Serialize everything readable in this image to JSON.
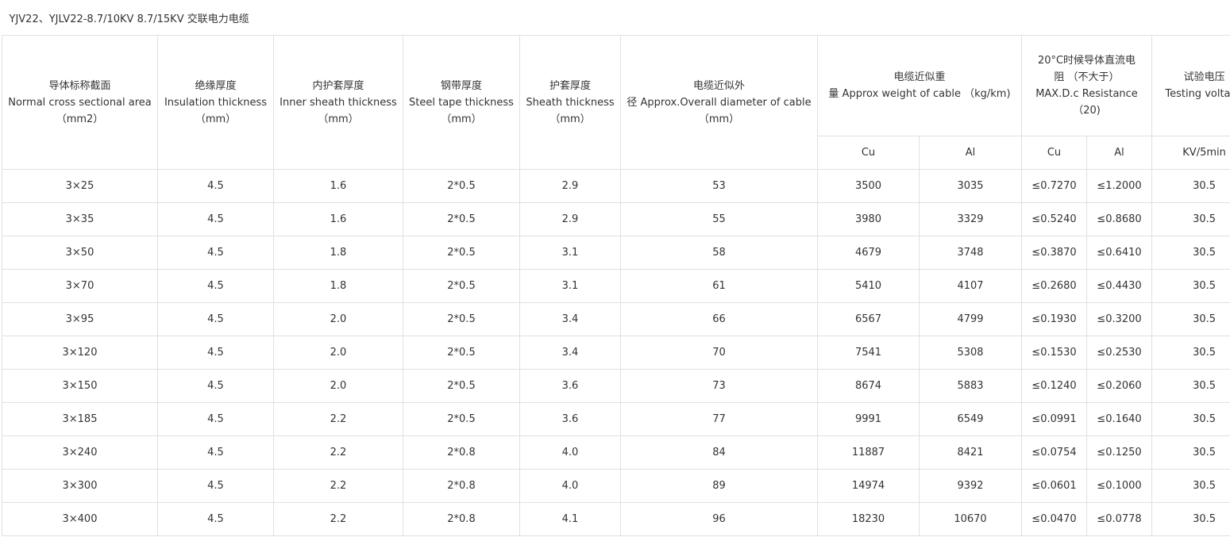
{
  "title": "YJV22、YJLV22-8.7/10KV  8.7/15KV  交联电力电缆",
  "headers": {
    "area": {
      "cn": "导体标称截面",
      "en": "Normal cross sectional area",
      "unit": "（mm2）"
    },
    "insulation": {
      "cn": "绝缘厚度",
      "en": "Insulation thickness",
      "unit": "（mm）"
    },
    "inner": {
      "cn": "内护套厚度",
      "en": "Inner sheath thickness",
      "unit": "（mm）"
    },
    "steel": {
      "cn": "钢带厚度",
      "en": "Steel tape thickness",
      "unit": "（mm）"
    },
    "sheath": {
      "cn": "护套厚度",
      "en": "Sheath thickness",
      "unit": "（mm）"
    },
    "diameter": {
      "line1": "电缆近似外",
      "line2": "径 Approx.Overall diameter of cable",
      "unit": "（mm）"
    },
    "weight": {
      "line1": "电缆近似重",
      "line2": "量 Approx weight of cable （kg/km)"
    },
    "resistance": {
      "line1": "20°C时候导体直流电",
      "line2": "阻 （不大于）",
      "line3": "MAX.D.c       Resistance",
      "line4": "（20)"
    },
    "voltage": {
      "line1": "试验电压",
      "line2": "Testing voltage"
    },
    "sub": {
      "cu1": "Cu",
      "al1": "Al",
      "cu2": "Cu",
      "al2": "Al",
      "kv": "KV/5min"
    }
  },
  "rows": [
    [
      "3×25",
      "4.5",
      "1.6",
      "2*0.5",
      "2.9",
      "53",
      "3500",
      "3035",
      "≤0.7270",
      "≤1.2000",
      "30.5"
    ],
    [
      "3×35",
      "4.5",
      "1.6",
      "2*0.5",
      "2.9",
      "55",
      "3980",
      "3329",
      "≤0.5240",
      "≤0.8680",
      "30.5"
    ],
    [
      "3×50",
      "4.5",
      "1.8",
      "2*0.5",
      "3.1",
      "58",
      "4679",
      "3748",
      "≤0.3870",
      "≤0.6410",
      "30.5"
    ],
    [
      "3×70",
      "4.5",
      "1.8",
      "2*0.5",
      "3.1",
      "61",
      "5410",
      "4107",
      "≤0.2680",
      "≤0.4430",
      "30.5"
    ],
    [
      "3×95",
      "4.5",
      "2.0",
      "2*0.5",
      "3.4",
      "66",
      "6567",
      "4799",
      "≤0.1930",
      "≤0.3200",
      "30.5"
    ],
    [
      "3×120",
      "4.5",
      "2.0",
      "2*0.5",
      "3.4",
      "70",
      "7541",
      "5308",
      "≤0.1530",
      "≤0.2530",
      "30.5"
    ],
    [
      "3×150",
      "4.5",
      "2.0",
      "2*0.5",
      "3.6",
      "73",
      "8674",
      "5883",
      "≤0.1240",
      "≤0.2060",
      "30.5"
    ],
    [
      "3×185",
      "4.5",
      "2.2",
      "2*0.5",
      "3.6",
      "77",
      "9991",
      "6549",
      "≤0.0991",
      "≤0.1640",
      "30.5"
    ],
    [
      "3×240",
      "4.5",
      "2.2",
      "2*0.8",
      "4.0",
      "84",
      "11887",
      "8421",
      "≤0.0754",
      "≤0.1250",
      "30.5"
    ],
    [
      "3×300",
      "4.5",
      "2.2",
      "2*0.8",
      "4.0",
      "89",
      "14974",
      "9392",
      "≤0.0601",
      "≤0.1000",
      "30.5"
    ],
    [
      "3×400",
      "4.5",
      "2.2",
      "2*0.8",
      "4.1",
      "96",
      "18230",
      "10670",
      "≤0.0470",
      "≤0.0778",
      "30.5"
    ]
  ]
}
